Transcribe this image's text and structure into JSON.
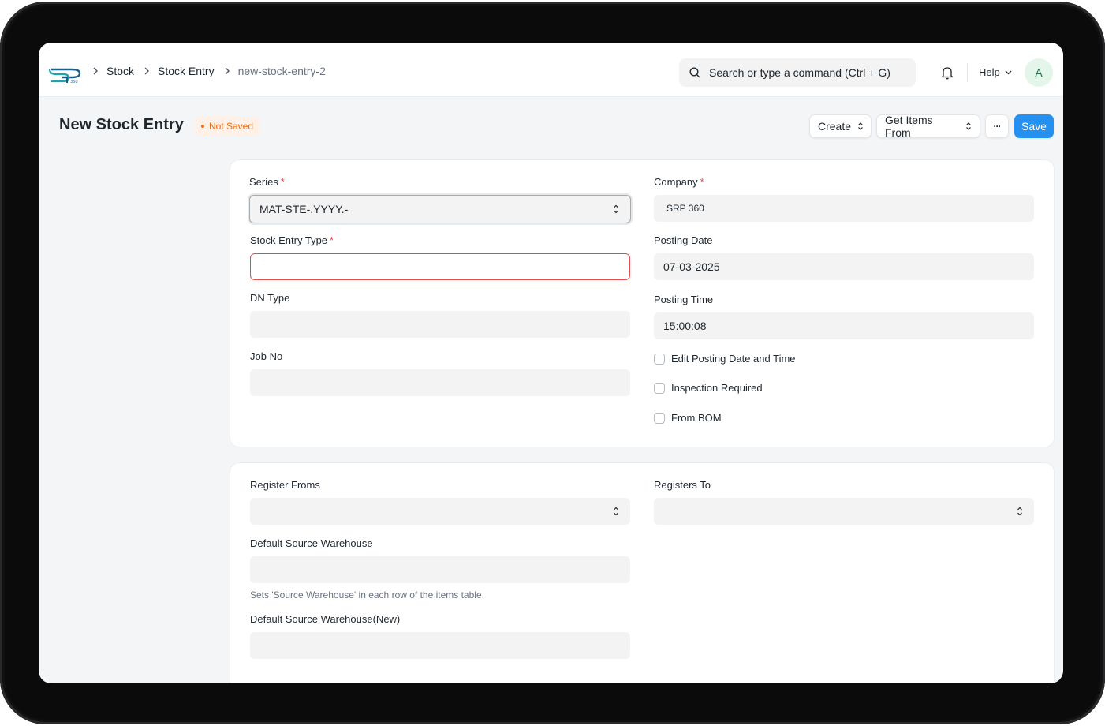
{
  "breadcrumbs": [
    "Stock",
    "Stock Entry",
    "new-stock-entry-2"
  ],
  "search": {
    "placeholder": "Search or type a command (Ctrl + G)"
  },
  "nav": {
    "help_label": "Help",
    "avatar_initial": "A"
  },
  "page": {
    "title": "New Stock Entry",
    "status": "Not Saved"
  },
  "actions": {
    "create": "Create",
    "get_items_from": "Get Items From",
    "more": "···",
    "save": "Save"
  },
  "section1": {
    "series": {
      "label": "Series",
      "value": "MAT-STE-.YYYY.-"
    },
    "stock_entry_type": {
      "label": "Stock Entry Type",
      "value": ""
    },
    "dn_type": {
      "label": "DN Type",
      "value": ""
    },
    "job_no": {
      "label": "Job No",
      "value": ""
    },
    "company": {
      "label": "Company",
      "value": "SRP 360"
    },
    "posting_date": {
      "label": "Posting Date",
      "value": "07-03-2025"
    },
    "posting_time": {
      "label": "Posting Time",
      "value": "15:00:08"
    },
    "checkboxes": {
      "edit_posting": {
        "label": "Edit Posting Date and Time",
        "checked": false
      },
      "inspection": {
        "label": "Inspection Required",
        "checked": false
      },
      "from_bom": {
        "label": "From BOM",
        "checked": false
      }
    }
  },
  "section2": {
    "register_froms": {
      "label": "Register Froms",
      "value": ""
    },
    "registers_to": {
      "label": "Registers To",
      "value": ""
    },
    "default_source_warehouse": {
      "label": "Default Source Warehouse",
      "value": "",
      "description": "Sets 'Source Warehouse' in each row of the items table."
    },
    "default_source_warehouse_new": {
      "label": "Default Source Warehouse(New)",
      "value": ""
    }
  },
  "colors": {
    "primary": "#2490ef",
    "status_orange": "#e86c13",
    "required_red": "#e24c4c",
    "avatar_green": "#16794c"
  }
}
